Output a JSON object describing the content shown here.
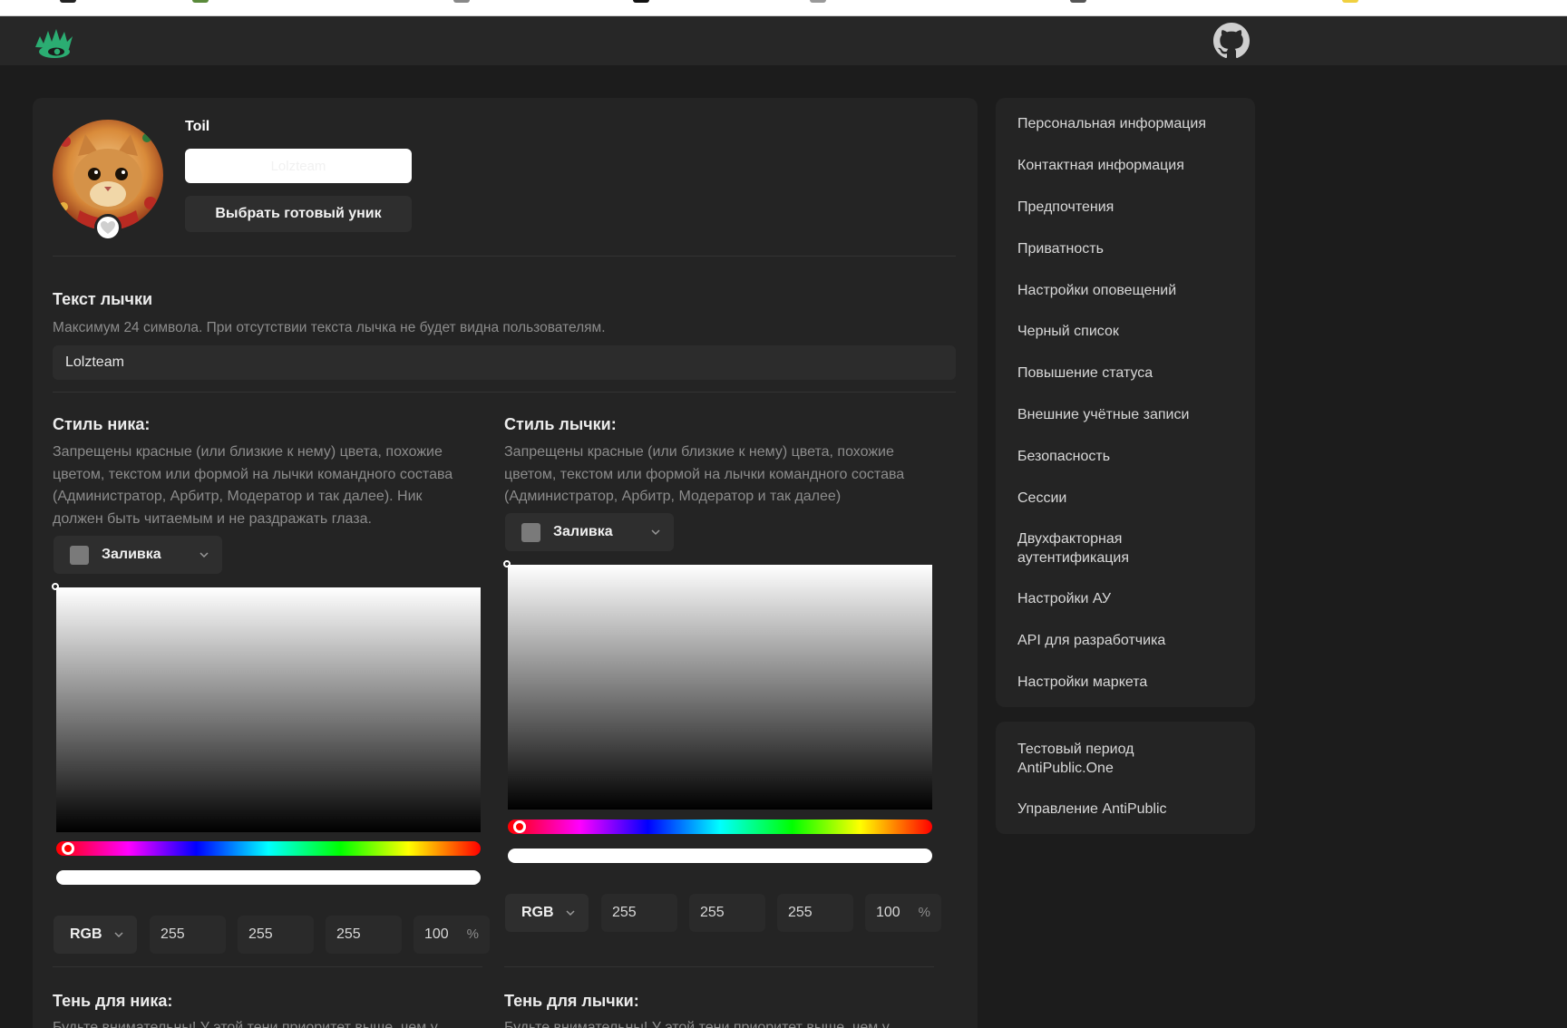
{
  "colors": {
    "background": "#1c1c1c",
    "card": "#242424",
    "topbar": "#272727",
    "accent": "#2bad72",
    "text": "#d8d8d8",
    "muted": "#8c8c8c"
  },
  "header": {
    "logo_icon": "lolz-logo-icon",
    "github_icon": "github-icon"
  },
  "profile": {
    "username": "Toil",
    "name_input_value": "Lolzteam",
    "pick_unik_label": "Выбрать готовый уник",
    "avatar_badge_icon": "heart-icon"
  },
  "badge_text": {
    "title": "Текст лычки",
    "hint": "Максимум 24 символа. При отсутствии текста лычка не будет видна пользователям.",
    "value": "Lolzteam"
  },
  "nick_style": {
    "title": "Стиль ника:",
    "hint": "Запрещены красные (или близкие к нему) цвета, похожие цветом, текстом или формой на лычки командного состава (Администратор, Арбитр, Модератор и так далее). Ник должен быть читаемым и не раздражать глаза.",
    "fill_label": "Заливка",
    "mode": "RGB",
    "r": "255",
    "g": "255",
    "b": "255",
    "alpha": "100",
    "alpha_unit": "%",
    "hue": 0
  },
  "badge_style": {
    "title": "Стиль лычки:",
    "hint": "Запрещены красные (или близкие к нему) цвета, похожие цветом, текстом или формой на лычки командного состава (Администратор, Арбитр, Модератор и так далее)",
    "fill_label": "Заливка",
    "mode": "RGB",
    "r": "255",
    "g": "255",
    "b": "255",
    "alpha": "100",
    "alpha_unit": "%",
    "hue": 0
  },
  "nick_shadow": {
    "title": "Тень для ника:",
    "hint": "Будьте внимательны! У этой тени приоритет выше, чем у"
  },
  "badge_shadow": {
    "title": "Тень для лычки:",
    "hint": "Будьте внимательны! У этой тени приоритет выше, чем у"
  },
  "sidebar": {
    "items": [
      "Персональная информация",
      "Контактная информация",
      "Предпочтения",
      "Приватность",
      "Настройки оповещений",
      "Черный список",
      "Повышение статуса",
      "Внешние учётные записи",
      "Безопасность",
      "Сессии",
      "Двухфакторная аутентификация",
      "Настройки АУ",
      "API для разработчика",
      "Настройки маркета"
    ],
    "extra_items": [
      "Тестовый период AntiPublic.One",
      "Управление AntiPublic"
    ]
  }
}
